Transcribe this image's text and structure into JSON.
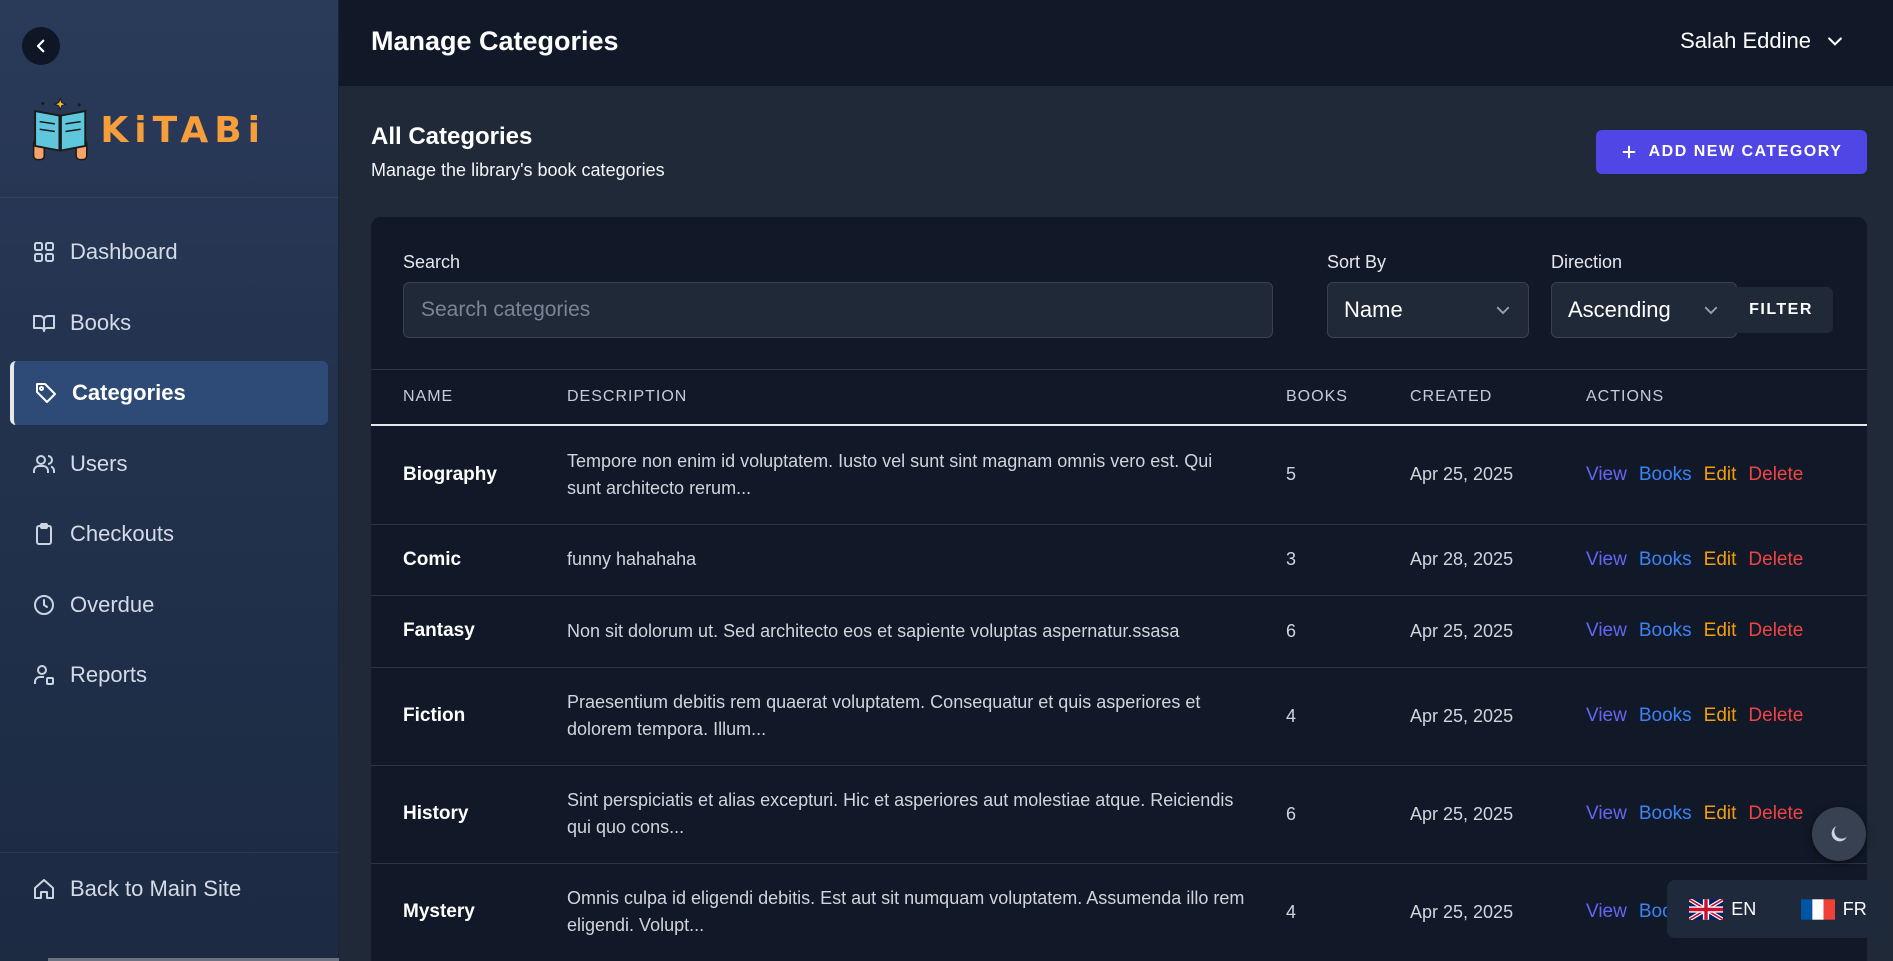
{
  "sidebar": {
    "logo_text": "KiTABi",
    "items": [
      {
        "label": "Dashboard",
        "icon": "grid-icon"
      },
      {
        "label": "Books",
        "icon": "book-open-icon"
      },
      {
        "label": "Categories",
        "icon": "tag-icon",
        "active": true
      },
      {
        "label": "Users",
        "icon": "users-icon"
      },
      {
        "label": "Checkouts",
        "icon": "clipboard-icon"
      },
      {
        "label": "Overdue",
        "icon": "clock-icon"
      },
      {
        "label": "Reports",
        "icon": "user-chart-icon"
      }
    ],
    "back_to_main": "Back to Main Site"
  },
  "header": {
    "title": "Manage Categories",
    "user_name": "Salah Eddine"
  },
  "main": {
    "section_title": "All Categories",
    "section_subtitle": "Manage the library's book categories",
    "add_button": "ADD NEW CATEGORY"
  },
  "filters": {
    "search_label": "Search",
    "search_placeholder": "Search categories",
    "sort_label": "Sort By",
    "sort_value": "Name",
    "direction_label": "Direction",
    "direction_value": "Ascending",
    "filter_button": "FILTER"
  },
  "table": {
    "columns": [
      "NAME",
      "DESCRIPTION",
      "BOOKS",
      "CREATED",
      "ACTIONS"
    ],
    "actions": {
      "view": "View",
      "books": "Books",
      "edit": "Edit",
      "delete": "Delete"
    },
    "rows": [
      {
        "name": "Biography",
        "description": "Tempore non enim id voluptatem. Iusto vel sunt sint magnam omnis vero est. Qui sunt architecto rerum...",
        "books": "5",
        "created": "Apr 25, 2025"
      },
      {
        "name": "Comic",
        "description": "funny hahahaha",
        "books": "3",
        "created": "Apr 28, 2025"
      },
      {
        "name": "Fantasy",
        "description": "Non sit dolorum ut. Sed architecto eos et sapiente voluptas aspernatur.ssasa",
        "books": "6",
        "created": "Apr 25, 2025"
      },
      {
        "name": "Fiction",
        "description": "Praesentium debitis rem quaerat voluptatem. Consequatur et quis asperiores et dolorem tempora. Illum...",
        "books": "4",
        "created": "Apr 25, 2025"
      },
      {
        "name": "History",
        "description": "Sint perspiciatis et alias excepturi. Hic et asperiores aut molestiae atque. Reiciendis qui quo cons...",
        "books": "6",
        "created": "Apr 25, 2025"
      },
      {
        "name": "Mystery",
        "description": "Omnis culpa id eligendi debitis. Est aut sit numquam voluptatem. Assumenda illo rem eligendi. Volupt...",
        "books": "4",
        "created": "Apr 25, 2025"
      }
    ]
  },
  "language": {
    "en": "EN",
    "fr": "FR"
  },
  "colors": {
    "accent": "#4f46e5",
    "view": "#6366f1",
    "books": "#3b82f6",
    "edit": "#f59e0b",
    "delete": "#ef4444",
    "logo": "#f59e3b"
  }
}
